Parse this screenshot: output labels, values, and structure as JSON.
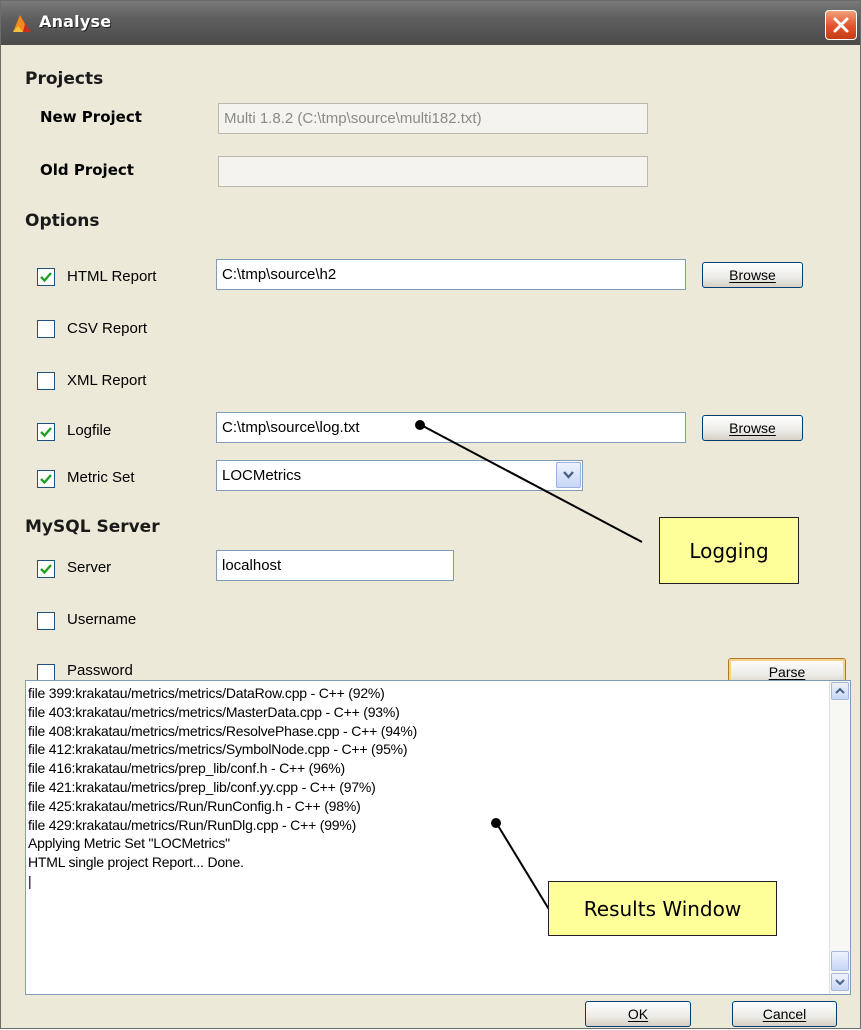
{
  "window": {
    "title": "Analyse",
    "app_icon": "app-logo-icon",
    "close_icon": "close-icon"
  },
  "projects": {
    "heading": "Projects",
    "new_project_label": "New Project",
    "new_project_value": "Multi 1.8.2 (C:\\tmp\\source\\multi182.txt)",
    "old_project_label": "Old Project",
    "old_project_value": ""
  },
  "options": {
    "heading": "Options",
    "html_report": {
      "label": "HTML Report",
      "checked": true,
      "value": "C:\\tmp\\source\\h2",
      "browse": "Browse"
    },
    "csv_report": {
      "label": "CSV Report",
      "checked": false
    },
    "xml_report": {
      "label": "XML Report",
      "checked": false
    },
    "logfile": {
      "label": "Logfile",
      "checked": true,
      "value": "C:\\tmp\\source\\log.txt",
      "browse": "Browse"
    },
    "metric_set": {
      "label": "Metric Set",
      "checked": true,
      "value": "LOCMetrics"
    }
  },
  "mysql": {
    "heading": "MySQL Server",
    "server": {
      "label": "Server",
      "checked": true,
      "value": "localhost"
    },
    "username": {
      "label": "Username",
      "checked": false
    },
    "password": {
      "label": "Password",
      "checked": false
    },
    "parse_button": "Parse"
  },
  "results": {
    "lines": [
      "file 399:krakatau/metrics/metrics/DataRow.cpp - C++ (92%)",
      "file 403:krakatau/metrics/metrics/MasterData.cpp - C++ (93%)",
      "file 408:krakatau/metrics/metrics/ResolvePhase.cpp - C++ (94%)",
      "file 412:krakatau/metrics/metrics/SymbolNode.cpp - C++ (95%)",
      "file 416:krakatau/metrics/prep_lib/conf.h - C++ (96%)",
      "file 421:krakatau/metrics/prep_lib/conf.yy.cpp - C++ (97%)",
      "file 425:krakatau/metrics/Run/RunConfig.h - C++ (98%)",
      "file 429:krakatau/metrics/Run/RunDlg.cpp - C++ (99%)",
      "Applying Metric Set \"LOCMetrics\"",
      "HTML single project Report... Done.",
      "|"
    ]
  },
  "footer": {
    "ok": "OK",
    "cancel": "Cancel"
  },
  "callouts": {
    "logging": "Logging",
    "results_window": "Results Window"
  },
  "colors": {
    "titlebar": "#5e5e5e",
    "dialog_bg": "#ece9d8",
    "callout_bg": "#ffff99",
    "close_button": "#e0522a"
  }
}
